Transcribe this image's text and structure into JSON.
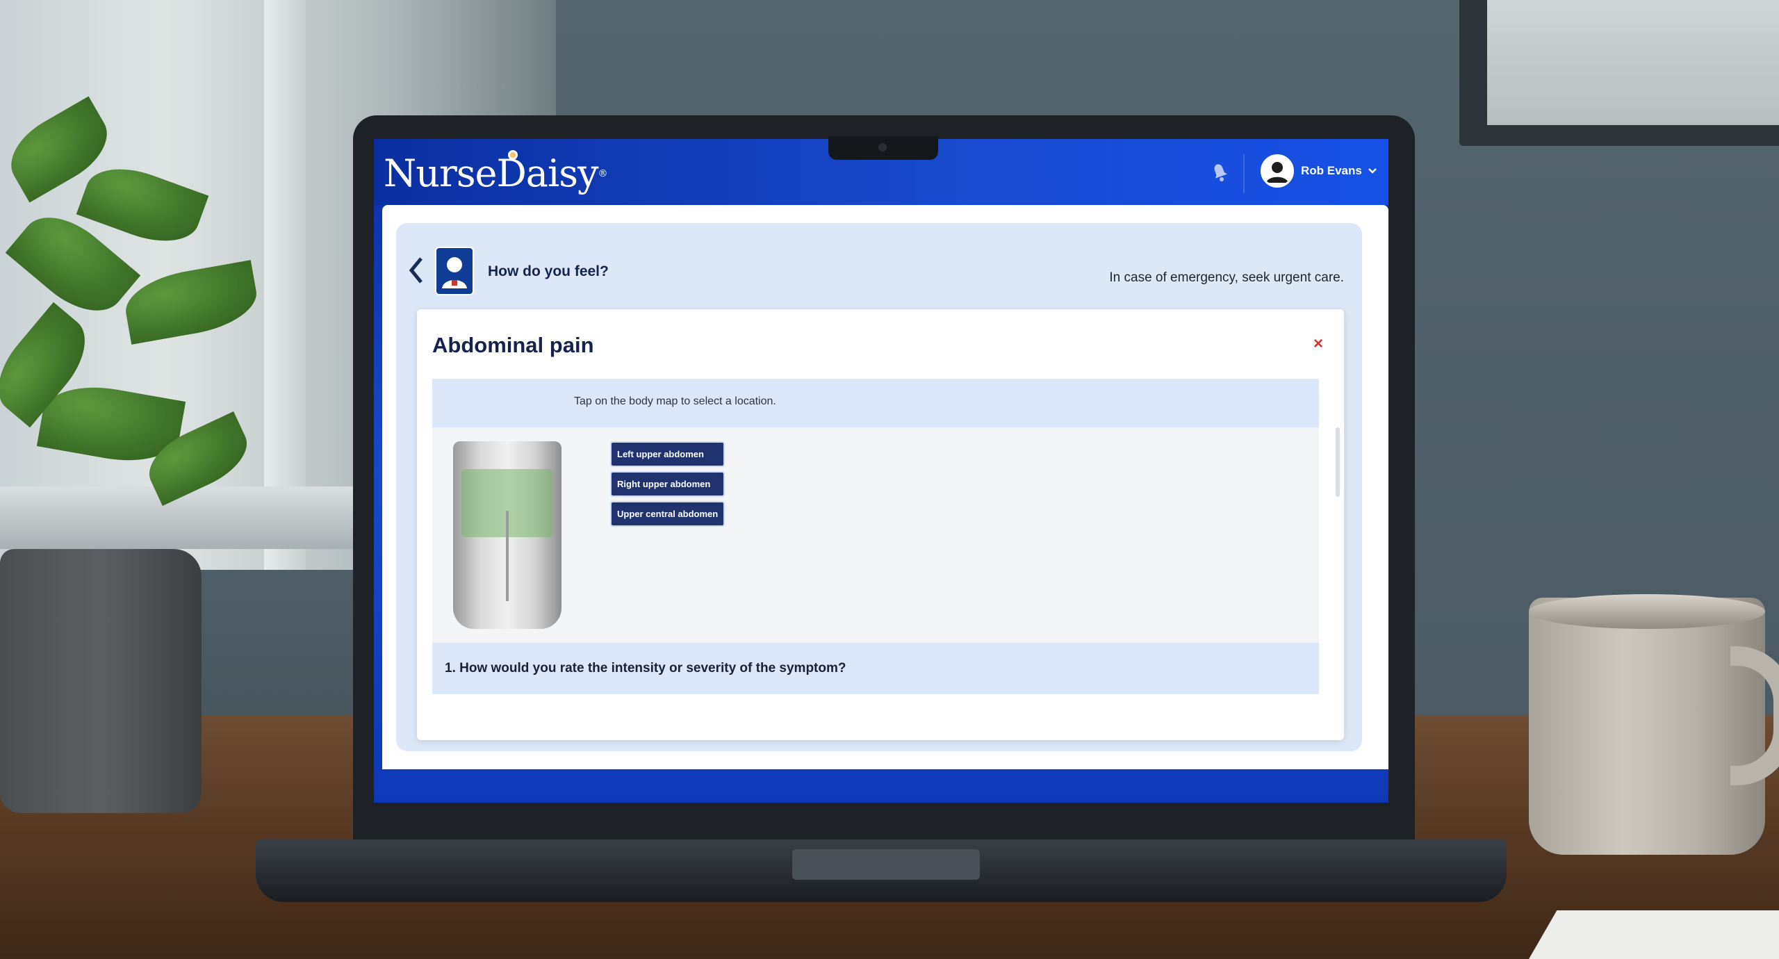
{
  "app": {
    "logo": "NurseDaisy",
    "logo_mark": "®"
  },
  "header": {
    "user_name": "Rob Evans",
    "dropdown_icon": "chevron-down-icon",
    "notification_icon": "bell-icon"
  },
  "panel": {
    "title": "How do you feel?",
    "emergency_note": "In case of emergency, seek urgent care.",
    "back_icon": "chevron-left-icon"
  },
  "card": {
    "title": "Abdominal pain",
    "close_label": "×",
    "instruction": "Tap on the body map to select a location.",
    "regions": [
      {
        "label": "Left upper abdomen"
      },
      {
        "label": "Right upper abdomen"
      },
      {
        "label": "Upper central abdomen"
      }
    ],
    "question": "1. How would you rate the intensity or severity of the symptom?"
  },
  "colors": {
    "brand_blue": "#1a4bd0",
    "chip_navy": "#20336e",
    "panel_light": "#dce8f8",
    "highlight_green": "#78b46e",
    "close_red": "#d0342c"
  }
}
